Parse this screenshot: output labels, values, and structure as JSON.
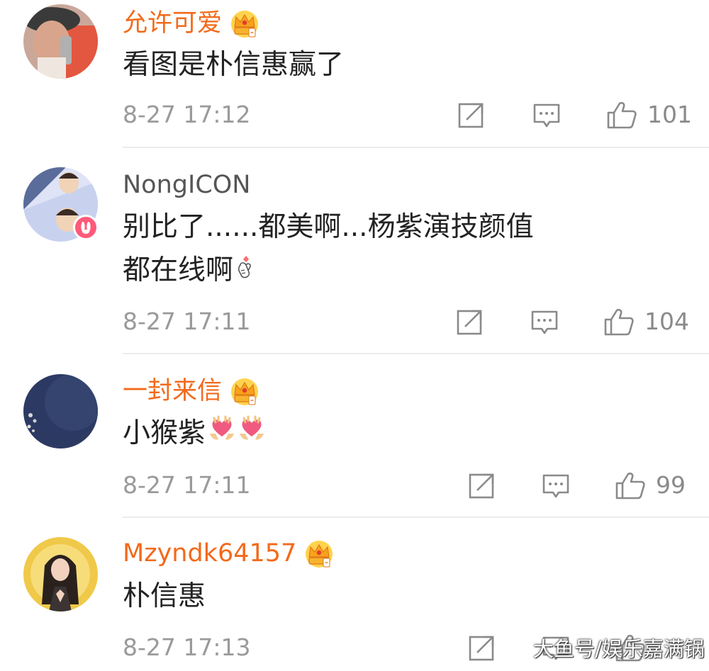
{
  "comments": [
    {
      "username": "允许可爱",
      "vip": true,
      "lines": [
        "看图是朴信惠赢了"
      ],
      "timestamp": "8-27 17:12",
      "like_count": "101"
    },
    {
      "username": "NongICON",
      "vip": false,
      "verified_badge": true,
      "lines": [
        "别比了......都美啊...杨紫演技颜值",
        "都在线啊"
      ],
      "line_emoji": "finger-heart-emoji",
      "timestamp": "8-27 17:11",
      "like_count": "104"
    },
    {
      "username": "一封来信",
      "vip": true,
      "lines": [
        "小猴紫"
      ],
      "line_emoji": "heart-hands-emoji",
      "timestamp": "8-27 17:11",
      "like_count": "99"
    },
    {
      "username": "Mzyndk64157",
      "vip": true,
      "lines": [
        "朴信惠"
      ],
      "timestamp": "8-27 17:13",
      "like_count": ""
    }
  ],
  "icons": {
    "share": "share-icon",
    "reply": "comment-icon",
    "like": "thumbs-up-icon",
    "vip": "crown-badge-icon"
  },
  "colors": {
    "vip_name": "#f26a1b",
    "normal_name": "#555555",
    "body_text": "#222222",
    "meta_text": "#9a9a9a",
    "icon_gray": "#8a8a8a",
    "divider": "#ececec"
  },
  "watermark": "大鱼号/娱乐嘉满锅"
}
